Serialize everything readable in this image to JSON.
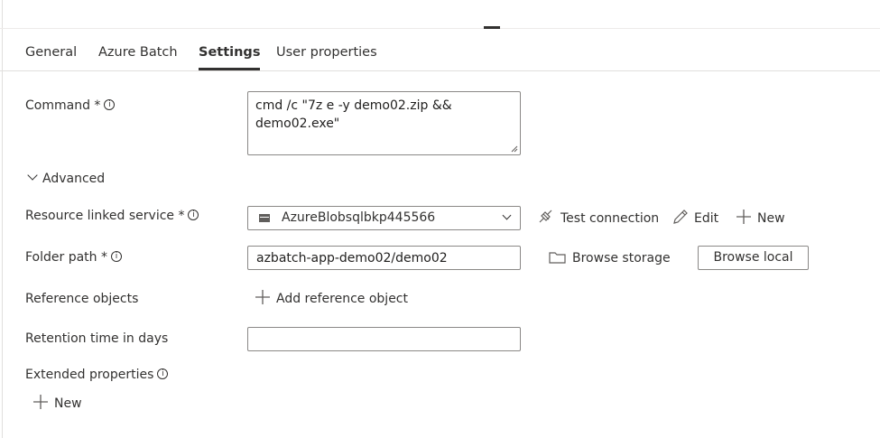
{
  "tabs": [
    {
      "label": "General"
    },
    {
      "label": "Azure Batch"
    },
    {
      "label": "Settings"
    },
    {
      "label": "User properties"
    }
  ],
  "command": {
    "label": "Command *",
    "value_line1": "cmd /c \"7z e -y demo02.zip &&",
    "value_line2": "demo02.exe\""
  },
  "advanced": {
    "label": "Advanced"
  },
  "resource": {
    "label": "Resource linked service *",
    "value": "AzureBlobsqlbkp445566",
    "test_connection": "Test connection",
    "edit": "Edit",
    "new": "New"
  },
  "folder": {
    "label": "Folder path *",
    "value": "azbatch-app-demo02/demo02",
    "browse_storage": "Browse storage",
    "browse_local": "Browse local"
  },
  "reference": {
    "label": "Reference objects",
    "add": "Add reference object"
  },
  "retention": {
    "label": "Retention time in days",
    "value": ""
  },
  "extended": {
    "label": "Extended properties",
    "new": "New"
  }
}
